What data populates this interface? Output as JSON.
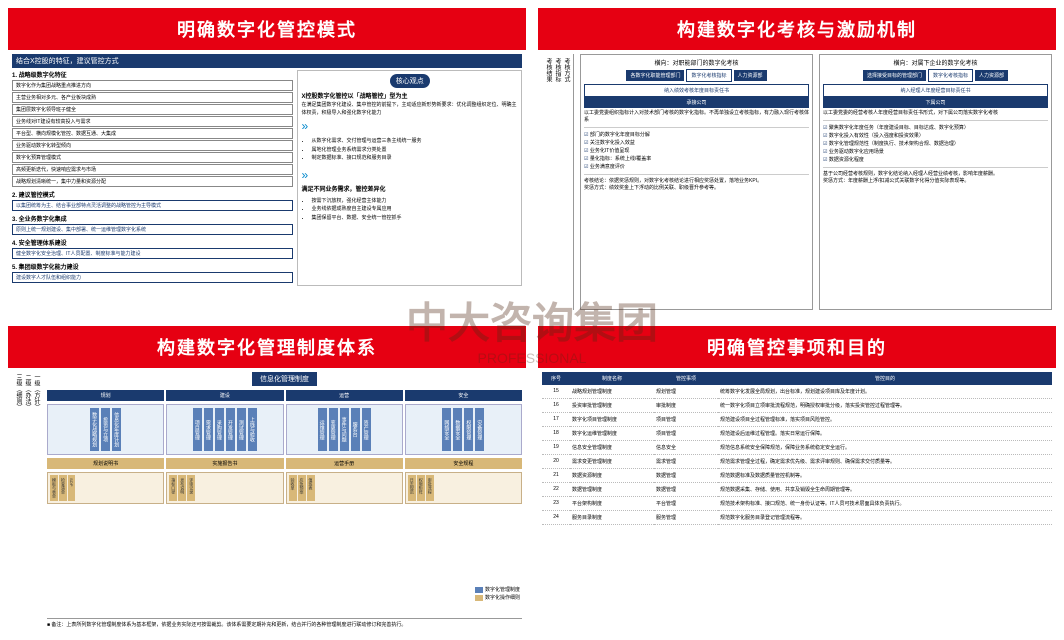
{
  "watermark": "中大咨询集团",
  "watermark_sub": "PROFESSIONAL",
  "panels": {
    "p1": {
      "title": "明确数字化管控模式",
      "subhead": "结合X控股的特征，建议管控方式",
      "sec1_title": "1. 战略级数字化特征",
      "sec1_items": [
        "数字化作为集团战略重点推进方向",
        "主营业务相对多元、各产业板块成熟",
        "集团层数字化领导班子健全",
        "业务线对IT建设有较高投入与需求",
        "平台型、横向规模化管控、数据互通、大集成",
        "业务驱动数字化转型倾向",
        "数字化预算管理模式",
        "高频更新迭代，快速响应需求与市场",
        "战略规划清晰统一，集中力量和资源分配"
      ],
      "sec2_title": "2. 建议管控模式",
      "sec2_items": [
        "以集团统筹为主、结合事业部特点灵活调整的战略管控为主导模式"
      ],
      "sec3_title": "3. 全业务数字化集成",
      "sec3_items": [
        "原则上统一规划建设、集中部署、统一运维管理数字化系统"
      ],
      "sec4_title": "4. 安全管理体系建设",
      "sec4_items": [
        "健全数字化安全治理、IT人员配置、制度标准与能力建设"
      ],
      "sec5_title": "5. 集团级数字化能力建设",
      "sec5_items": [
        "建设数字人才队伍和组织能力"
      ],
      "core_label": "核心观点",
      "right_title": "X控股数字化管控以「战略管控」型为主",
      "right_body1": "在满足集团数字化建设、集中管控的前提下，主动适应新形势新要求：优化调整组织定位、明确主体权责，积极导入和强化数字化能力",
      "right_sep1": "»",
      "right_body2_items": [
        "从数字化需求、交付管理与运营三条主线统一服务",
        "属地化管理业务系统需求分类处置",
        "制定数据标准、接口规范和服务目录"
      ],
      "right_sep2": "»",
      "right_title2": "满足不同业务需求，管控差异化",
      "right_body3_items": [
        "按需下沉放权，强化经营主体能力",
        "业务线依据成熟度自主建设专属应用",
        "集团保留平台、数据、安全统一管控抓手"
      ]
    },
    "p2": {
      "title": "构建数字化考核与激励机制",
      "left_head": "横向：对职能部门的数字化考核",
      "right_head": "横向：对属下企业的数字化考核",
      "side_labels": [
        "考核方式",
        "考核指标",
        "考核结果"
      ],
      "l_tags": [
        "各数字化职能管理部门",
        "数字化考核指标",
        "人力资源部"
      ],
      "l_sub1": "纳入绩效考核年度目标责任书",
      "l_sub2": "承接公司",
      "l_t1": "以工委党委组织指标计入对技术部门考核的数字化指标。不再单独设立考核指标，有力融入现行考核体系",
      "l_checks": [
        "部门的数字化年度目标分解",
        "关注数字化投入效益",
        "业务化IT价值呈现",
        "量化指标：系统上线/覆盖率",
        "业务满意度评价"
      ],
      "l_t2": "考核结论：依据奖惩规则，对数字化考核结论进行相应奖惩处置，落地业务KPI。",
      "l_t3": "奖惩方式：绩效奖金上下浮动的比例关联、职级晋升参考等。",
      "r_tags": [
        "选择接受目标的管理部门",
        "数字化考核指标",
        "人力资源部"
      ],
      "r_sub1": "纳入经理人年度经营目标责任书",
      "r_sub2": "下属公司",
      "r_t1": "以工委党委的经营考核人年度经营目标责任书形式，对下属公司落实数字化考核",
      "r_checks": [
        "聚焦数字化年度任务（年度建设目标、目标达成、数字化预算）",
        "数字化投入有效性（投入强度和投资效果）",
        "数字化管理规范性（制度执行、技术架构合规、数据治理）",
        "业务驱动数字化应用场景",
        "数据资源化程度"
      ],
      "r_t2": "基于公司经营考核规则，数字化结论纳入经理人经营业绩考核，影响年度薪酬。",
      "r_t3": "奖惩方式：年度薪酬上浮/扣减公式关联数字化得分值实际表现等。"
    },
    "p3": {
      "title": "构建数字化管理制度体系",
      "side_labels": [
        "一级（方针）",
        "二级（办法）",
        "三级（细则）"
      ],
      "top": "信息化管理制度",
      "cats": [
        "规划",
        "建设",
        "运营",
        "安全"
      ],
      "cat_items": {
        "规划": [
          "数字化战略规划",
          "投资与立项",
          "信息化年度计划"
        ],
        "建设": [
          "项目管理",
          "需求管理",
          "采购管理",
          "开发管理",
          "测试管理",
          "上线与验收"
        ],
        "运营": [
          "运维管理",
          "变更管理",
          "事件与问题",
          "服务台",
          "资产管理"
        ],
        "安全": [
          "网络安全",
          "数据安全",
          "权限管理",
          "灾备管理"
        ]
      },
      "sub_cats": [
        "规划说明书",
        "实施报告书",
        "运营手册",
        "安全规程"
      ],
      "sub_items": [
        "模板与表单",
        "检查清单",
        "SOP",
        "指标口径",
        "发布说明",
        "评审记录",
        "验收单",
        "应急预案",
        "值班表",
        "日志规范",
        "权限矩阵",
        "审批流程"
      ],
      "legend_blue": "数字化管理制度",
      "legend_yellow": "数字化操作细则",
      "footnote": "■ 备注：上表所列数字化管理制度体系为基本框架，依据业务实际还可按需裁剪。该体系需要定期补充和更新，结合并行的各种管理制度进行联动修订和完善执行。"
    },
    "p4": {
      "title": "明确管控事项和目的",
      "cols": [
        "序号",
        "制度名称",
        "管控事项",
        "管控目的"
      ],
      "rows": [
        {
          "n": "15",
          "name": "战略规划管理制度",
          "matter": "规划管理",
          "goal": "统筹数字化发展全局规划，出台标准，规划建设项目库及年度计划。"
        },
        {
          "n": "16",
          "name": "投资审批管理制度",
          "matter": "审批制度",
          "goal": "统一数字化项目立项审批流程规范，明确授权审批分级，落实投资管控过程管理等。"
        },
        {
          "n": "17",
          "name": "数字化项目管理制度",
          "matter": "项目管理",
          "goal": "规范建设项目全过程管理标准，落实项目风险管控。"
        },
        {
          "n": "18",
          "name": "数字化运维管理制度",
          "matter": "项目管理",
          "goal": "规范建设后运维过程管理。落实日常运行保障。"
        },
        {
          "n": "19",
          "name": "信息安全管理制度",
          "matter": "信息安全",
          "goal": "规范信息系统安全保障规范，保障业务系统稳定安全运行。"
        },
        {
          "n": "20",
          "name": "需求变更管理制度",
          "matter": "需求管理",
          "goal": "规范需求管理全过程，确定需求优先级、需求评审规则、确保需求交付质量等。"
        },
        {
          "n": "21",
          "name": "数据资源制度",
          "matter": "数据管理",
          "goal": "规范数据标准及数据质量管控机制等。"
        },
        {
          "n": "22",
          "name": "数据管理制度",
          "matter": "数据管理",
          "goal": "规范数据采集、存储、使用、共享及销毁全生命周期管理等。"
        },
        {
          "n": "23",
          "name": "平台架构制度",
          "matter": "平台管理",
          "goal": "规范技术架构标准、接口规范、统一身份认证等。IT人员可技术层面具体负责执行。"
        },
        {
          "n": "24",
          "name": "服务目录制度",
          "matter": "服务管理",
          "goal": "规范数字化服务目录登记管理流程等。"
        }
      ]
    }
  }
}
